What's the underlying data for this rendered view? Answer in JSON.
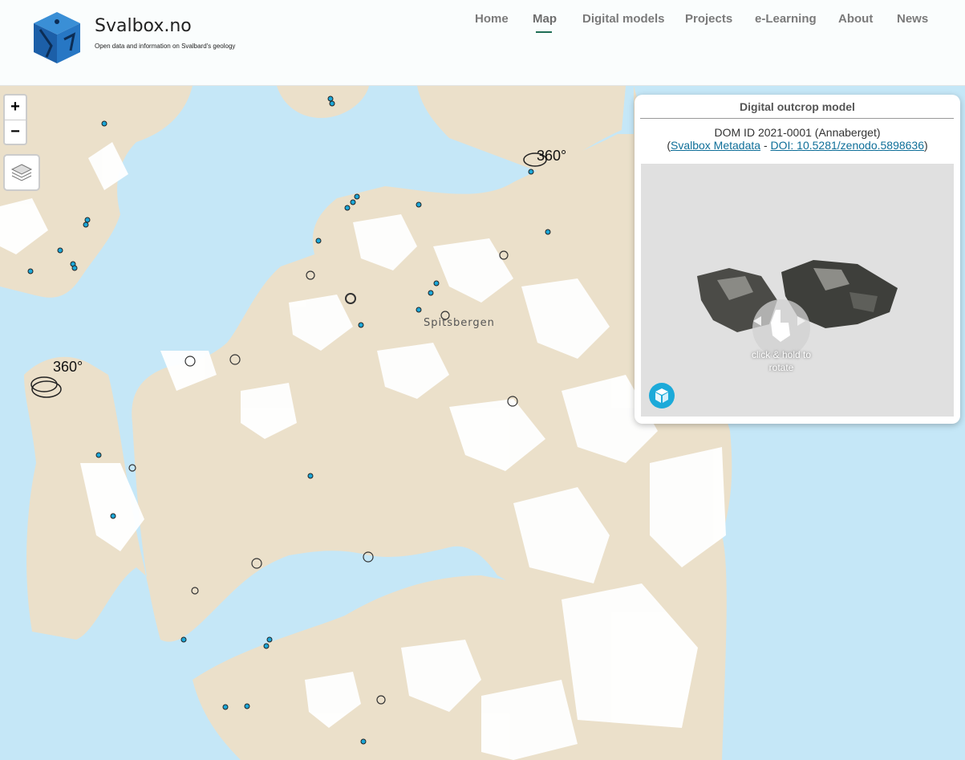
{
  "site": {
    "title": "Svalbox.no",
    "tagline": "Open data and information on Svalbard's geology"
  },
  "nav": [
    {
      "label": "Home"
    },
    {
      "label": "Map",
      "active": true
    },
    {
      "label": "Digital models"
    },
    {
      "label": "Projects"
    },
    {
      "label": "e-Learning"
    },
    {
      "label": "About"
    },
    {
      "label": "News"
    }
  ],
  "map": {
    "place_label": "Spitsbergen",
    "badge_text": "360°",
    "zoom_in": "+",
    "zoom_out": "−",
    "layers_icon": "layers-icon",
    "marker_color": "#1ca7d8",
    "land_color": "#ebe0ca",
    "water_color": "#c5e7f7"
  },
  "popup": {
    "title": "Digital outcrop model",
    "dom_line": "DOM ID 2021-0001 (Annaberget)",
    "paren_open": "(",
    "metadata_link": "Svalbox Metadata",
    "separator": " - ",
    "doi_link": "DOI: 10.5281/zenodo.5898636",
    "paren_close": ")",
    "viewer_hint": "click & hold to rotate",
    "viewer_icon": "sketchfab-icon"
  }
}
